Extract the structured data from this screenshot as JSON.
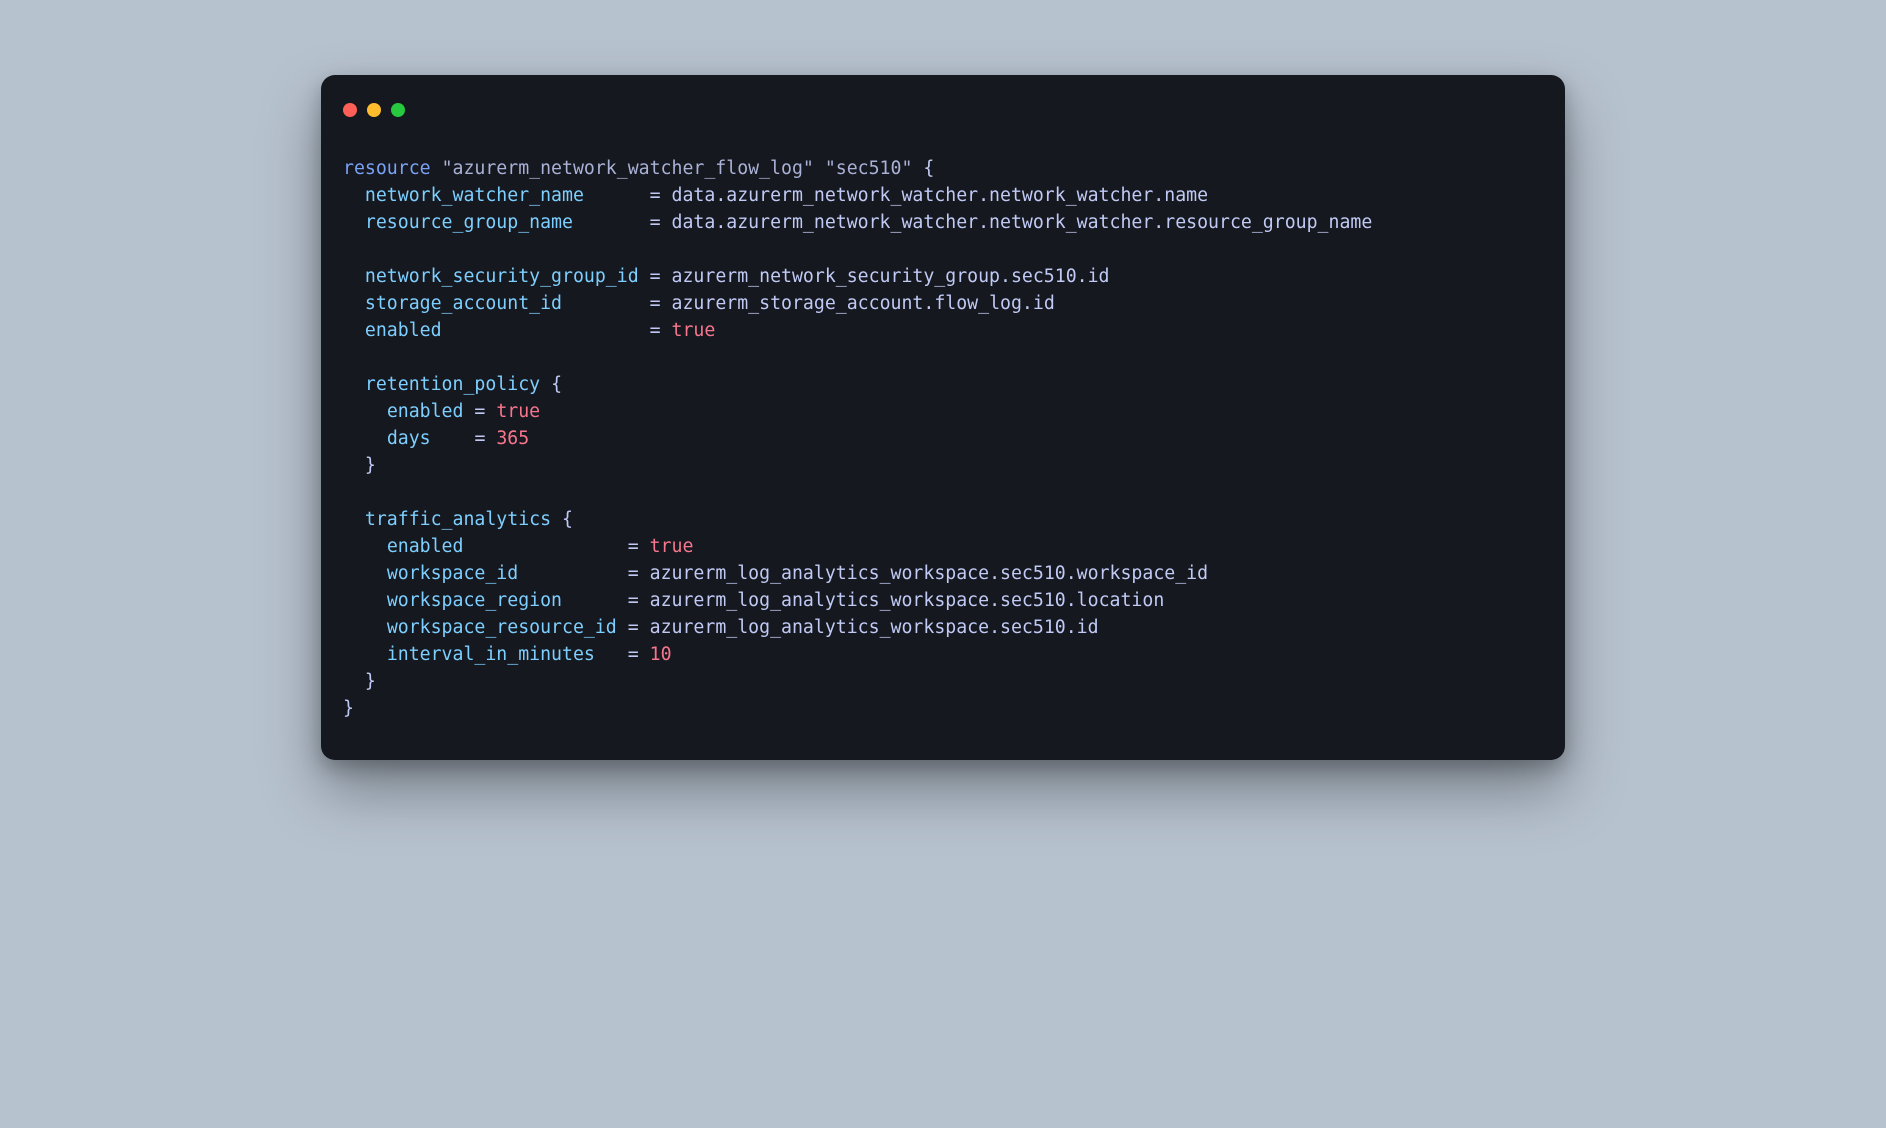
{
  "window": {
    "traffic_lights": {
      "close_color": "#ff5f56",
      "minimize_color": "#ffbd2e",
      "maximize_color": "#27c93f"
    }
  },
  "code": {
    "language": "terraform",
    "resource_keyword": "resource",
    "resource_type": "\"azurerm_network_watcher_flow_log\"",
    "resource_name": "\"sec510\"",
    "open_brace": "{",
    "close_brace": "}",
    "eq": "=",
    "lines": {
      "network_watcher_name": {
        "key": "network_watcher_name",
        "val": "data.azurerm_network_watcher.network_watcher.name"
      },
      "resource_group_name": {
        "key": "resource_group_name",
        "val": "data.azurerm_network_watcher.network_watcher.resource_group_name"
      },
      "network_security_group_id": {
        "key": "network_security_group_id",
        "val": "azurerm_network_security_group.sec510.id"
      },
      "storage_account_id": {
        "key": "storage_account_id",
        "val": "azurerm_storage_account.flow_log.id"
      },
      "enabled": {
        "key": "enabled",
        "val": "true"
      }
    },
    "retention_policy": {
      "header": "retention_policy",
      "enabled": {
        "key": "enabled",
        "val": "true"
      },
      "days": {
        "key": "days",
        "val": "365"
      }
    },
    "traffic_analytics": {
      "header": "traffic_analytics",
      "enabled": {
        "key": "enabled",
        "val": "true"
      },
      "workspace_id": {
        "key": "workspace_id",
        "val": "azurerm_log_analytics_workspace.sec510.workspace_id"
      },
      "workspace_region": {
        "key": "workspace_region",
        "val": "azurerm_log_analytics_workspace.sec510.location"
      },
      "workspace_resource_id": {
        "key": "workspace_resource_id",
        "val": "azurerm_log_analytics_workspace.sec510.id"
      },
      "interval_in_minutes": {
        "key": "interval_in_minutes",
        "val": "10"
      }
    }
  }
}
